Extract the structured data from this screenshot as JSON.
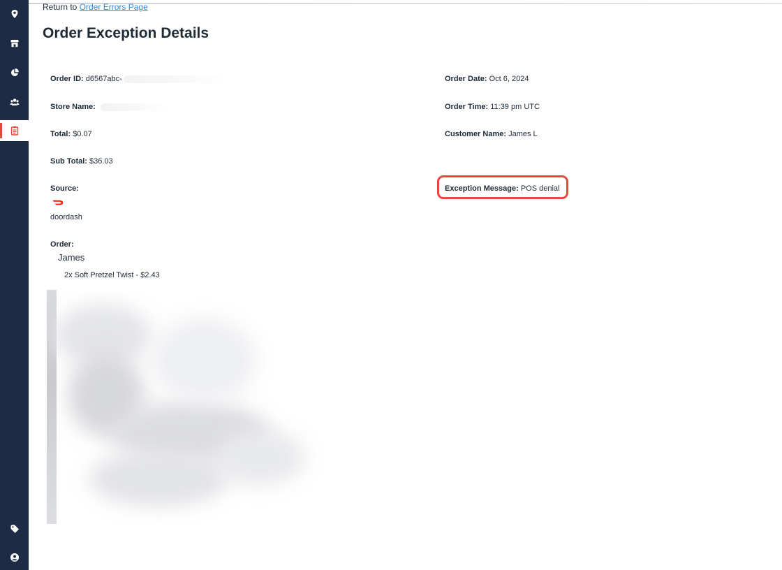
{
  "sidebar": {
    "items": [
      {
        "icon": "location-pin-icon"
      },
      {
        "icon": "store-icon"
      },
      {
        "icon": "pie-chart-icon"
      },
      {
        "icon": "users-icon"
      },
      {
        "icon": "clipboard-icon",
        "active": true
      },
      {
        "icon": "tag-icon"
      },
      {
        "icon": "account-circle-icon"
      }
    ]
  },
  "header": {
    "return_prefix": "Return to",
    "return_link": "Order Errors Page",
    "title": "Order Exception Details"
  },
  "details": {
    "order_id_label": "Order ID:",
    "order_id_value": "d6567abc-",
    "store_name_label": "Store Name:",
    "total_label": "Total:",
    "total_value": "$0.07",
    "sub_total_label": "Sub Total:",
    "sub_total_value": "$36.03",
    "source_label": "Source:",
    "source_value": "doordash",
    "order_label": "Order:",
    "order_date_label": "Order Date:",
    "order_date_value": "Oct 6, 2024",
    "order_time_label": "Order Time:",
    "order_time_value": "11:39 pm UTC",
    "customer_name_label": "Customer Name:",
    "customer_name_value": "James L",
    "exception_message_label": "Exception Message:",
    "exception_message_value": "POS denial"
  },
  "order": {
    "customer": "James",
    "items": [
      {
        "text": "2x Soft Pretzel Twist - $2.43"
      }
    ]
  },
  "colors": {
    "sidebar_bg": "#1d2b45",
    "active_accent": "#e04a3c",
    "link": "#3a86c8",
    "highlight": "#e8473d",
    "doordash": "#eb1700"
  }
}
